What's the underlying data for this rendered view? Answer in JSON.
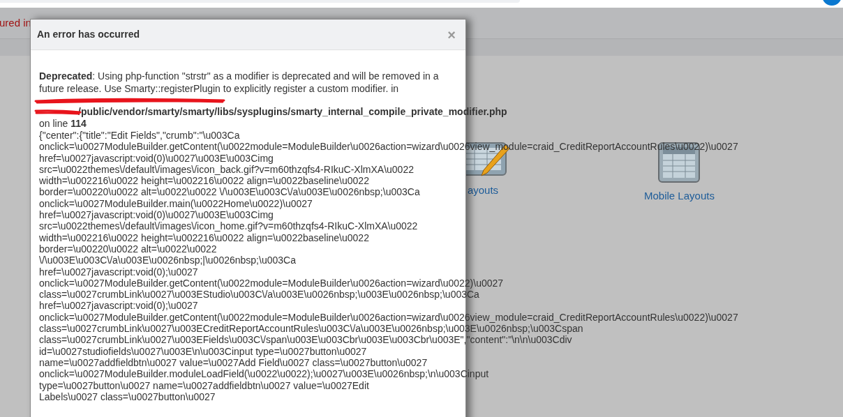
{
  "background": {
    "error_fragment": "ured in",
    "tiles": [
      {
        "kind": "layouts",
        "label": "ayouts"
      },
      {
        "kind": "mobile",
        "label": "Mobile Layouts"
      }
    ]
  },
  "dialog": {
    "title": "An error has occurred",
    "close": "×",
    "message": {
      "level": "Deprecated",
      "text": ": Using php-function \"strstr\" as a modifier is deprecated and will be removed in a future release. Use Smarty::registerPlugin to explicitly register a custom modifier. in"
    },
    "file_path": "/public/vendor/smarty/smarty/libs/sysplugins/smarty_internal_compile_private_modifier.php",
    "line_label": "on line",
    "line_number": "114",
    "dump_lines": [
      "{\"center\":{\"title\":\"Edit Fields\",\"crumb\":\"\\u003Ca",
      "onclick=\\u0027ModuleBuilder.getContent(\\u0022module=ModuleBuilder\\u0026action=wizard\\u0026view_module=craid_CreditReportAccountRules\\u0022)\\u0027",
      "href=\\u0027javascript:void(0)\\u0027\\u003E\\u003Cimg",
      "src=\\u0022themes\\/default\\/images\\/icon_back.gif?v=m60thzqfs4-RIkuC-XlmXA\\u0022",
      "width=\\u002216\\u0022 height=\\u002216\\u0022 align=\\u0022baseline\\u0022",
      "border=\\u00220\\u0022 alt=\\u0022\\u0022 \\/\\u003E\\u003C\\/a\\u003E\\u0026nbsp;\\u003Ca",
      "onclick=\\u0027ModuleBuilder.main(\\u0022Home\\u0022)\\u0027",
      "href=\\u0027javascript:void(0)\\u0027\\u003E\\u003Cimg",
      "src=\\u0022themes\\/default\\/images\\/icon_home.gif?v=m60thzqfs4-RIkuC-XlmXA\\u0022",
      "width=\\u002216\\u0022 height=\\u002216\\u0022 align=\\u0022baseline\\u0022",
      "border=\\u00220\\u0022 alt=\\u0022\\u0022",
      "\\/\\u003E\\u003C\\/a\\u003E\\u0026nbsp;|\\u0026nbsp;\\u003Ca",
      "href=\\u0027javascript:void(0);\\u0027",
      "onclick=\\u0027ModuleBuilder.getContent(\\u0022module=ModuleBuilder\\u0026action=wizard\\u0022)\\u0027",
      "class=\\u0027crumbLink\\u0027\\u003EStudio\\u003C\\/a\\u003E\\u0026nbsp;\\u003E\\u0026nbsp;\\u003Ca",
      "href=\\u0027javascript:void(0);\\u0027",
      "onclick=\\u0027ModuleBuilder.getContent(\\u0022module=ModuleBuilder\\u0026action=wizard\\u0026view_module=craid_CreditReportAccountRules\\u0022)\\u0027",
      "class=\\u0027crumbLink\\u0027\\u003ECreditReportAccountRules\\u003C\\/a\\u003E\\u0026nbsp;\\u003E\\u0026nbsp;\\u003Cspan",
      "class=\\u0027crumbLink\\u0027\\u003EFields\\u003C\\/span\\u003E\\u003Cbr\\u003E\\u003Cbr\\u003E\",\"content\":\"\\n\\n\\u003Cdiv",
      "id=\\u0027studiofields\\u0027\\u003E\\n\\u003Cinput type=\\u0027button\\u0027",
      "name=\\u0027addfieldbtn\\u0027 value=\\u0027Add Field\\u0027 class=\\u0027button\\u0027",
      "onclick=\\u0027ModuleBuilder.moduleLoadField(\\u0022\\u0022);\\u0027\\u003E\\u0026nbsp;\\n\\u003Cinput",
      "type=\\u0027button\\u0027 name=\\u0027addfieldbtn\\u0027 value=\\u0027Edit",
      "Labels\\u0027 class=\\u0027button\\u0027"
    ]
  }
}
